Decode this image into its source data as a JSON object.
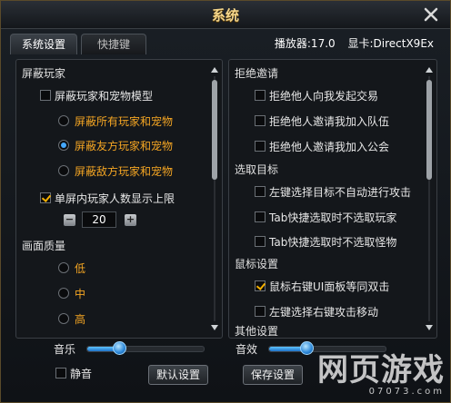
{
  "window": {
    "title": "系统"
  },
  "tabs": [
    {
      "label": "系统设置"
    },
    {
      "label": "快捷键"
    }
  ],
  "info": {
    "player": "播放器:17.0",
    "gpu": "显卡:DirectX9Ex"
  },
  "left": {
    "hide_players_section": "屏蔽玩家",
    "hide_models": "屏蔽玩家和宠物模型",
    "hide_all": "屏蔽所有玩家和宠物",
    "hide_friendly": "屏蔽友方玩家和宠物",
    "hide_enemy": "屏蔽敌方玩家和宠物",
    "limit_label": "单屏内玩家人数显示上限",
    "limit_value": "20",
    "quality_section": "画面质量",
    "quality_low": "低",
    "quality_mid": "中",
    "quality_high": "高"
  },
  "right": {
    "refuse_section": "拒绝邀请",
    "refuse_trade": "拒绝他人向我发起交易",
    "refuse_team": "拒绝他人邀请我加入队伍",
    "refuse_guild": "拒绝他人邀请我加入公会",
    "target_section": "选取目标",
    "no_auto_attack": "左键选择目标不自动进行攻击",
    "tab_no_player": "Tab快捷选取时不选取玩家",
    "tab_no_monster": "Tab快捷选取时不选取怪物",
    "mouse_section": "鼠标设置",
    "right_click_ui": "鼠标右键UI面板等同双击",
    "left_select_right_attack": "左键选择右键攻击移动",
    "other_section": "其他设置"
  },
  "bottom": {
    "music_label": "音乐",
    "music_level": 0.25,
    "sfx_label": "音效",
    "sfx_level": 0.3,
    "mute_label": "静音",
    "default_btn": "默认设置",
    "save_btn": "保存设置"
  },
  "watermark": {
    "big": "网页游戏",
    "small": "07073.com"
  },
  "colors": {
    "accent": "#f5a623",
    "title": "#f3d58b",
    "slider": "#2a86d8"
  }
}
